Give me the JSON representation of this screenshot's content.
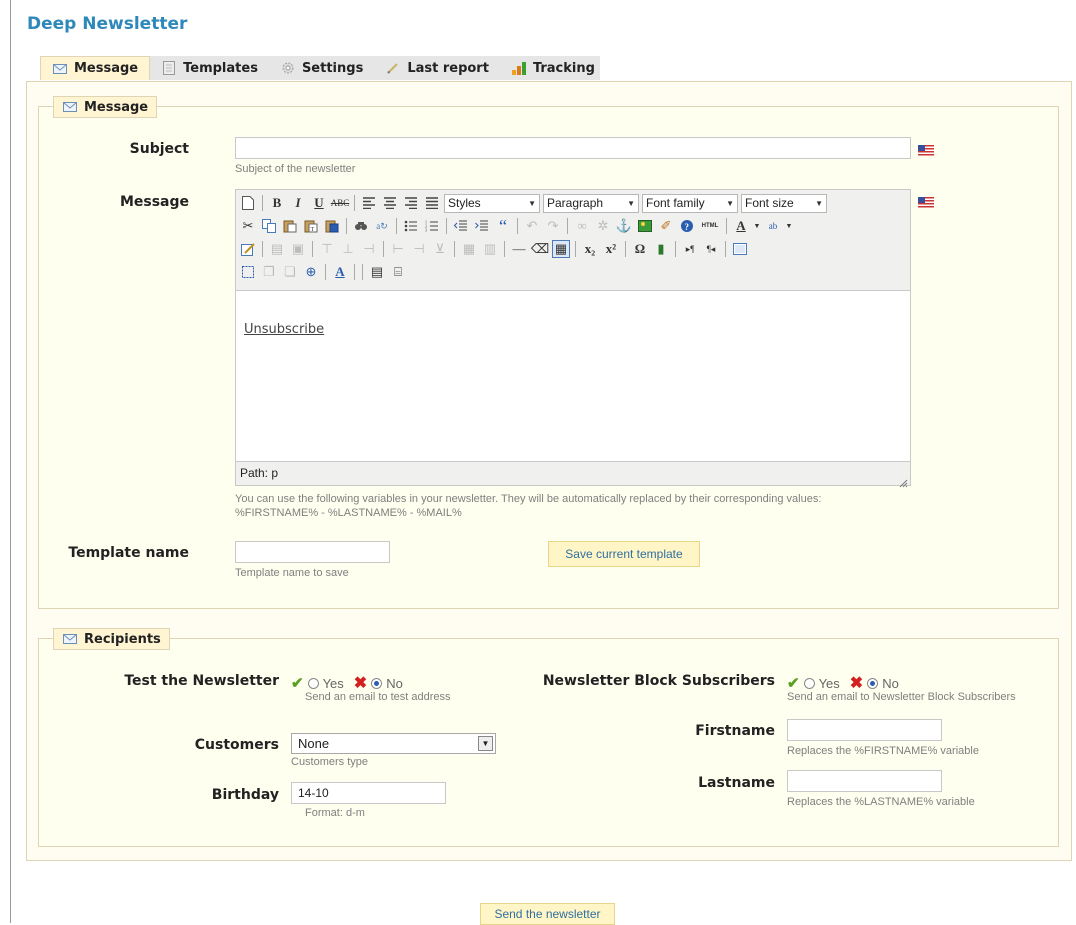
{
  "page": {
    "title": "Deep Newsletter"
  },
  "tabs": [
    {
      "label": "Message",
      "icon": "envelope-icon",
      "active": true
    },
    {
      "label": "Templates",
      "icon": "document-icon"
    },
    {
      "label": "Settings",
      "icon": "gear-icon"
    },
    {
      "label": "Last report",
      "icon": "pencil-icon"
    },
    {
      "label": "Tracking",
      "icon": "signal-bars-icon"
    }
  ],
  "message_section": {
    "legend": "Message",
    "subject": {
      "label": "Subject",
      "value": "",
      "hint": "Subject of the newsletter"
    },
    "message": {
      "label": "Message"
    },
    "editor": {
      "selects": {
        "styles": "Styles",
        "paragraph": "Paragraph",
        "font_family": "Font family",
        "font_size": "Font size"
      },
      "content_link": "Unsubscribe",
      "path": "Path: p"
    },
    "variables_note_line1": "You can use the following variables in your newsletter. They will be automatically replaced by their corresponding values:",
    "variables_note_line2": "%FIRSTNAME% - %LASTNAME% - %MAIL%",
    "template_name": {
      "label": "Template name",
      "value": "",
      "hint": "Template name to save"
    },
    "save_button": "Save current template"
  },
  "recipients_section": {
    "legend": "Recipients",
    "test": {
      "label": "Test the Newsletter",
      "yes": "Yes",
      "no": "No",
      "selected": "No",
      "hint": "Send an email to test address"
    },
    "block_subscribers": {
      "label": "Newsletter Block Subscribers",
      "yes": "Yes",
      "no": "No",
      "selected": "No",
      "hint": "Send an email to Newsletter Block Subscribers"
    },
    "customers": {
      "label": "Customers",
      "value": "None",
      "hint": "Customers type"
    },
    "birthday": {
      "label": "Birthday",
      "value": "14-10",
      "hint": "Format: d-m"
    },
    "firstname": {
      "label": "Firstname",
      "value": "",
      "hint": "Replaces the %FIRSTNAME% variable"
    },
    "lastname": {
      "label": "Lastname",
      "value": "",
      "hint": "Replaces the %LASTNAME% variable"
    }
  },
  "send_button": "Send the newsletter",
  "colors": {
    "title": "#2e88ba",
    "tab_active": "#fff5d3",
    "panel_bg": "#fffcf2",
    "button_text": "#2e6fa0"
  }
}
